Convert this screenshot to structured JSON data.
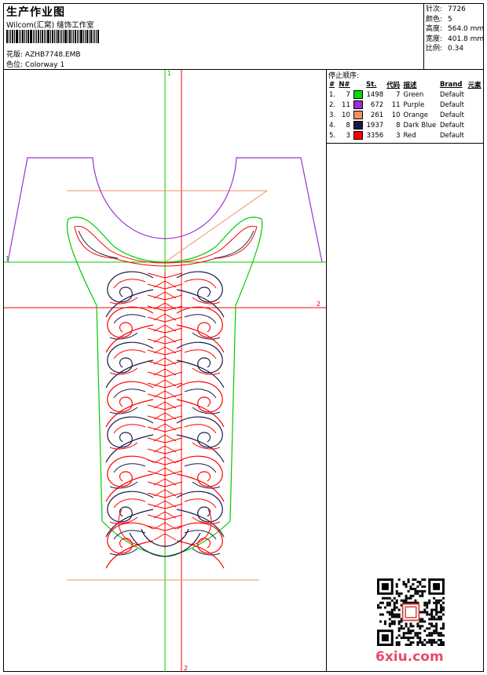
{
  "header": {
    "title": "生产作业图",
    "studio": "Wilcom(汇窝) 缝饰工作室",
    "design_label": "花版:",
    "design_value": "AZHB7748.EMB",
    "colorway_label": "色位:",
    "colorway_value": "Colorway 1"
  },
  "stats": [
    {
      "label": "针次:",
      "value": "7726"
    },
    {
      "label": "颜色:",
      "value": "5"
    },
    {
      "label": "高度:",
      "value": "564.0 mm"
    },
    {
      "label": "宽度:",
      "value": "401.8 mm"
    },
    {
      "label": "比例:",
      "value": "0.34"
    }
  ],
  "stop_sequence": {
    "title": "停止顺序:",
    "headers": [
      "#",
      "N#",
      "St.",
      "代码",
      "描述",
      "Brand",
      "元素"
    ],
    "rows": [
      {
        "index": "1.",
        "needle": "7",
        "color": "#00dd00",
        "stitches": "1498",
        "code": "7",
        "desc": "Green",
        "brand": "Default"
      },
      {
        "index": "2.",
        "needle": "11",
        "color": "#9b30d0",
        "stitches": "672",
        "code": "11",
        "desc": "Purple",
        "brand": "Default"
      },
      {
        "index": "3.",
        "needle": "10",
        "color": "#f09060",
        "stitches": "261",
        "code": "10",
        "desc": "Orange",
        "brand": "Default"
      },
      {
        "index": "4.",
        "needle": "8",
        "color": "#1a1a4a",
        "stitches": "1937",
        "code": "8",
        "desc": "Dark Blue",
        "brand": "Default"
      },
      {
        "index": "5.",
        "needle": "3",
        "color": "#ff0000",
        "stitches": "3356",
        "code": "3",
        "desc": "Red",
        "brand": "Default"
      }
    ]
  },
  "axes": {
    "top_marker": "1",
    "left_marker": "1",
    "right_marker": "2",
    "bottom_marker": "2"
  },
  "watermark": {
    "text": "6xiu.com"
  },
  "colors": {
    "green": "#00cc00",
    "red": "#ff0000",
    "purple": "#9b30d0",
    "darkblue": "#1a1a4a",
    "orange": "#f09060"
  },
  "icons": {
    "qr": "qr-code-icon"
  }
}
